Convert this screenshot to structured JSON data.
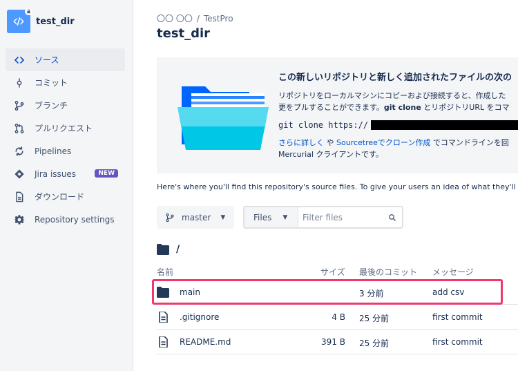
{
  "repo": {
    "name": "test_dir"
  },
  "sidebar": {
    "items": [
      {
        "label": "ソース",
        "icon": "code-icon",
        "active": true
      },
      {
        "label": "コミット",
        "icon": "commit-icon"
      },
      {
        "label": "ブランチ",
        "icon": "branch-icon"
      },
      {
        "label": "プルリクエスト",
        "icon": "pull-request-icon"
      },
      {
        "label": "Pipelines",
        "icon": "pipelines-icon"
      },
      {
        "label": "Jira issues",
        "icon": "jira-icon",
        "badge": "NEW"
      },
      {
        "label": "ダウンロード",
        "icon": "download-icon"
      },
      {
        "label": "Repository settings",
        "icon": "gear-icon"
      }
    ]
  },
  "breadcrumb": {
    "workspace": "〇〇 〇〇",
    "separator": "/",
    "project": "TestPro"
  },
  "page": {
    "title": "test_dir"
  },
  "info": {
    "title": "この新しいリポジトリと新しく追加されたファイルの次の",
    "line1": "リポジトリをローカルマシンにコピーおよび接続すると、作成した",
    "line2a": "更をプルすることができます。",
    "line2b": "git clone",
    "line2c": "とリポジトリURL をコマ",
    "git_cmd": "git clone https://",
    "learn_more": "さらに詳しく",
    "or": " や ",
    "sourcetree": "Sourcetreeでクローン作成",
    "line3": " でコマンドラインを回",
    "line4": "Mercurial クライアントです。"
  },
  "description": "Here's where you'll find this repository's source files. To give your users an idea of what they'll fin",
  "controls": {
    "branch": "master",
    "files_label": "Files",
    "filter_placeholder": "Filter files"
  },
  "path": "/",
  "table": {
    "headers": {
      "name": "名前",
      "size": "サイズ",
      "last_commit": "最後のコミット",
      "message": "メッセージ"
    },
    "rows": [
      {
        "type": "folder",
        "name": "main",
        "size": "",
        "last_commit": "3 分前",
        "message": "add csv"
      },
      {
        "type": "file",
        "name": ".gitignore",
        "size": "4 B",
        "last_commit": "25 分前",
        "message": "first commit"
      },
      {
        "type": "file",
        "name": "README.md",
        "size": "391 B",
        "last_commit": "25 分前",
        "message": "first commit"
      }
    ]
  },
  "colors": {
    "accent": "#0052CC",
    "highlight": "#F0386B",
    "badge": "#6554C0"
  }
}
